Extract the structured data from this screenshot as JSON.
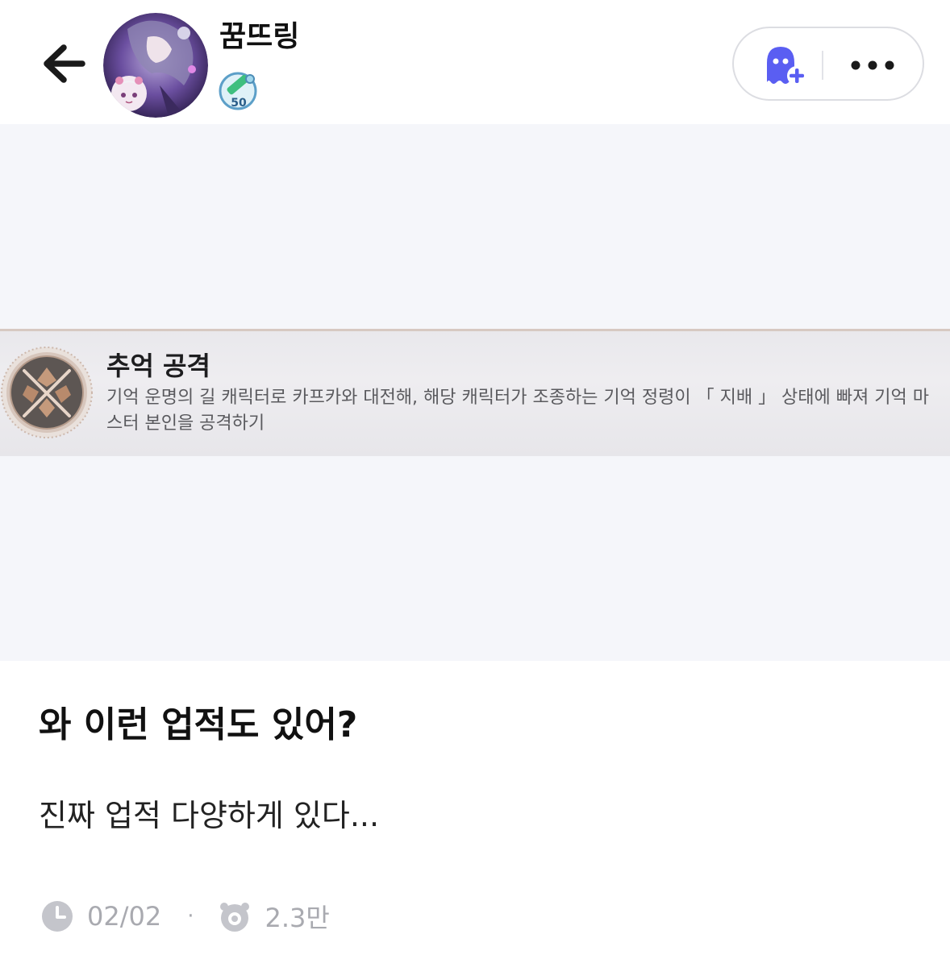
{
  "header": {
    "username": "꿈뜨링",
    "level_badge_text": "50",
    "back_icon": "arrow-left-icon",
    "follow_icon": "ghost-plus-icon",
    "more_icon": "more-dots-icon",
    "accent_color": "#5b5bf0"
  },
  "image": {
    "achievement_title": "추억 공격",
    "achievement_desc": "기억 운명의 길 캐릭터로 카프카와 대전해, 해당 캐릭터가 조종하는 기억 정령이 「 지배 」 상태에 빠져 기억 마스터 본인을 공격하기"
  },
  "post": {
    "title": "와 이런 업적도 있어?",
    "body": "진짜 업적 다양하게 있다..."
  },
  "meta": {
    "date": "02/02",
    "separator": "·",
    "views": "2.3만",
    "clock_icon": "clock-icon",
    "eye_icon": "view-count-icon"
  }
}
